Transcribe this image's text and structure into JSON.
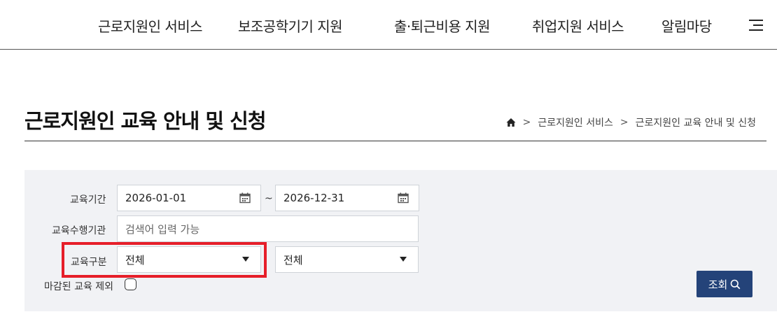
{
  "nav": {
    "items": [
      {
        "label": "근로지원인 서비스"
      },
      {
        "label": "보조공학기기 지원"
      },
      {
        "label": "출·퇴근비용 지원"
      },
      {
        "label": "취업지원 서비스"
      },
      {
        "label": "알림마당"
      }
    ],
    "menu_icon": "hamburger-menu-icon"
  },
  "page": {
    "title": "근로지원인 교육 안내 및 신청",
    "breadcrumb": {
      "home_icon": "home-icon",
      "separator": ">",
      "items": [
        "근로지원인 서비스",
        "근로지원인 교육 안내 및 신청"
      ]
    }
  },
  "search": {
    "period_label": "교육기간",
    "date_from": "2026-01-01",
    "date_to": "2026-12-31",
    "tilde": "~",
    "calendar_icon": "calendar-icon",
    "org_label": "교육수행기관",
    "org_placeholder": "검색어 입력 가능",
    "type_label": "교육구분",
    "type_select1": "전체",
    "type_select2": "전체",
    "exclude_closed_label": "마감된 교육 제외",
    "exclude_closed_checked": false,
    "search_button": "조회",
    "highlight_color": "#e61e29",
    "button_color": "#244379"
  }
}
